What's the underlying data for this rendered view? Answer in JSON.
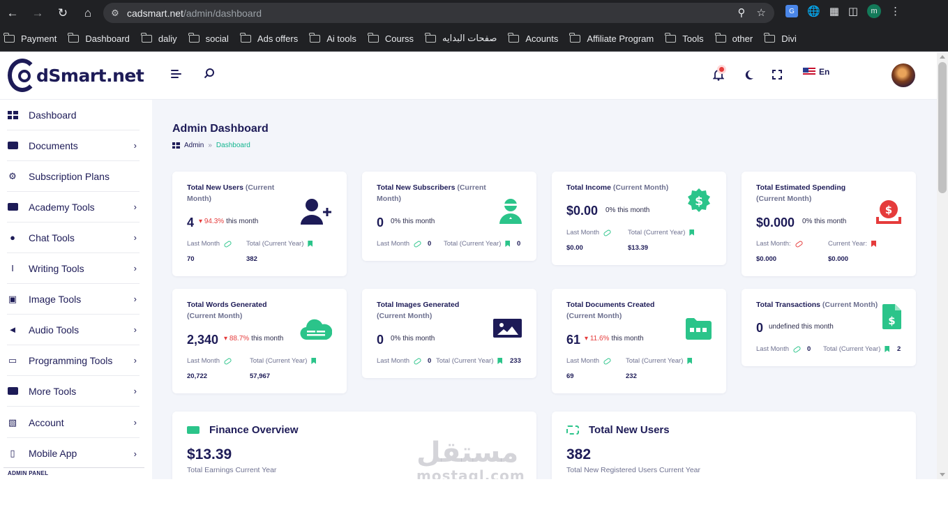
{
  "browser": {
    "url_host": "cadsmart.net",
    "url_path": "/admin/dashboard",
    "profile_initial": "m",
    "bookmarks": [
      "Payment",
      "Dashboard",
      "daliy",
      "social",
      "Ads offers",
      "Ai tools",
      "Courss",
      "صفحات البدايه",
      "Acounts",
      "Affiliate Program",
      "Tools",
      "other",
      "Divi"
    ]
  },
  "header": {
    "logo_text": "dSmart.net",
    "language": "En",
    "icons": [
      "menu-icon",
      "search-icon",
      "bell-icon",
      "moon-icon",
      "fullscreen-icon",
      "avatar"
    ]
  },
  "sidebar": {
    "items": [
      {
        "label": "Dashboard",
        "icon": "dashboard-icon",
        "has_children": false
      },
      {
        "label": "Documents",
        "icon": "folder-icon",
        "has_children": true
      },
      {
        "label": "Subscription Plans",
        "icon": "plans-icon",
        "has_children": false
      },
      {
        "label": "Academy Tools",
        "icon": "folder-icon",
        "has_children": true
      },
      {
        "label": "Chat Tools",
        "icon": "chat-icon",
        "has_children": true
      },
      {
        "label": "Writing Tools",
        "icon": "text-cursor-icon",
        "has_children": true
      },
      {
        "label": "Image Tools",
        "icon": "images-icon",
        "has_children": true
      },
      {
        "label": "Audio Tools",
        "icon": "speaker-icon",
        "has_children": true
      },
      {
        "label": "Programming Tools",
        "icon": "laptop-icon",
        "has_children": true
      },
      {
        "label": "More Tools",
        "icon": "toolbox-icon",
        "has_children": true
      },
      {
        "label": "Account",
        "icon": "account-icon",
        "has_children": true
      },
      {
        "label": "Mobile App",
        "icon": "mobile-icon",
        "has_children": true
      }
    ],
    "section_label": "ADMIN PANEL"
  },
  "page": {
    "title": "Admin Dashboard",
    "breadcrumb": {
      "root": "Admin",
      "sep": "»",
      "current": "Dashboard"
    }
  },
  "cards": {
    "new_users": {
      "title": "Total New Users",
      "title_suffix": "(Current Month)",
      "value": "4",
      "trend": "94.3%",
      "trend_text": "this month",
      "last_label": "Last Month",
      "last_value": "70",
      "total_label": "Total (Current Year)",
      "total_value": "382"
    },
    "new_subscribers": {
      "title": "Total New Subscribers",
      "title_suffix": "(Current Month)",
      "value": "0",
      "trend_text": "0% this month",
      "last_label": "Last Month",
      "last_value": "0",
      "total_label": "Total (Current Year)",
      "total_value": "0"
    },
    "income": {
      "title": "Total Income",
      "title_suffix": "(Current Month)",
      "value": "$0.00",
      "trend_text": "0% this month",
      "last_label": "Last Month",
      "last_value": "$0.00",
      "total_label": "Total (Current Year)",
      "total_value": "$13.39"
    },
    "spending": {
      "title": "Total Estimated Spending",
      "title_suffix": "(Current Month)",
      "value": "$0.000",
      "trend_text": "0% this month",
      "last_label": "Last Month:",
      "last_value": "$0.000",
      "total_label": "Current Year:",
      "total_value": "$0.000"
    },
    "words": {
      "title": "Total Words Generated",
      "title_suffix": "(Current Month)",
      "value": "2,340",
      "trend": "88.7%",
      "trend_text": "this month",
      "last_label": "Last Month",
      "last_value": "20,722",
      "total_label": "Total (Current Year)",
      "total_value": "57,967"
    },
    "images": {
      "title": "Total Images Generated",
      "title_suffix": "(Current Month)",
      "value": "0",
      "trend_text": "0% this month",
      "last_label": "Last Month",
      "last_value": "0",
      "total_label": "Total (Current Year)",
      "total_value": "233"
    },
    "documents": {
      "title": "Total Documents Created",
      "title_suffix": "(Current Month)",
      "value": "61",
      "trend": "11.6%",
      "trend_text": "this month",
      "last_label": "Last Month",
      "last_value": "69",
      "total_label": "Total (Current Year)",
      "total_value": "232"
    },
    "transactions": {
      "title": "Total Transactions",
      "title_suffix": "(Current Month)",
      "value": "0",
      "trend_text": "undefined this month",
      "last_label": "Last Month",
      "last_value": "0",
      "total_label": "Total (Current Year)",
      "total_value": "2"
    }
  },
  "panels": {
    "finance": {
      "title": "Finance Overview",
      "value": "$13.39",
      "sub": "Total Earnings Current Year"
    },
    "users": {
      "title": "Total New Users",
      "value": "382",
      "sub": "Total New Registered Users Current Year"
    }
  },
  "watermark": {
    "arabic": "مستقل",
    "latin": "mostaql.com"
  },
  "colors": {
    "navy": "#1d1b57",
    "green": "#2bc48a",
    "teal": "#13b58f",
    "red": "#e53b3b"
  }
}
